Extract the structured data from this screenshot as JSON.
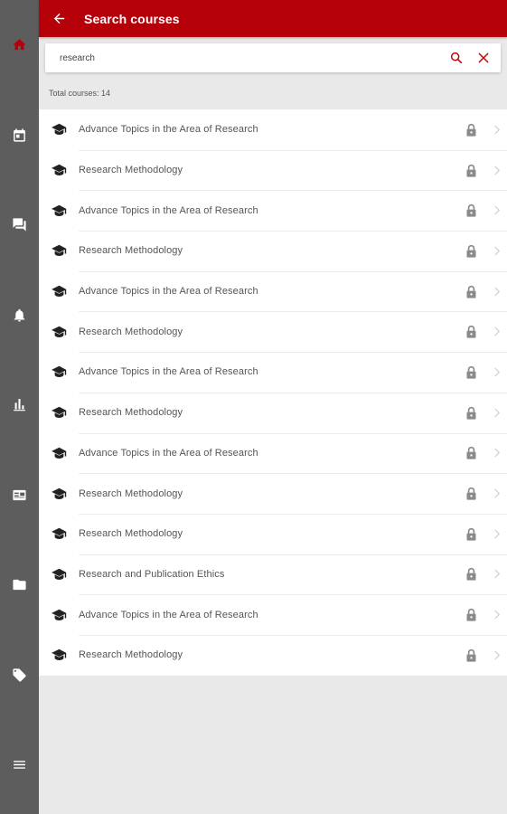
{
  "colors": {
    "brand": "#b50009",
    "rail": "#5d5d5d",
    "active_rail_icon": "#b50009"
  },
  "rail": {
    "items": [
      {
        "icon": "home-icon",
        "active": true
      },
      {
        "icon": "calendar-icon"
      },
      {
        "icon": "forum-icon"
      },
      {
        "icon": "bell-icon"
      },
      {
        "icon": "bar-chart-icon"
      },
      {
        "icon": "id-card-icon"
      },
      {
        "icon": "folder-icon"
      },
      {
        "icon": "tag-icon"
      },
      {
        "icon": "menu-icon"
      }
    ]
  },
  "appbar": {
    "title": "Search courses",
    "back_icon": "arrow-back-icon"
  },
  "search": {
    "value": "research",
    "search_icon": "search-icon",
    "clear_icon": "close-icon"
  },
  "total_label": "Total courses: 14",
  "courses": [
    {
      "title": "Advance Topics in the Area of Research"
    },
    {
      "title": "Research Methodology"
    },
    {
      "title": "Advance Topics in the Area of Research"
    },
    {
      "title": "Research Methodology"
    },
    {
      "title": "Advance Topics in the Area of Research"
    },
    {
      "title": "Research Methodology"
    },
    {
      "title": "Advance Topics in the Area of Research"
    },
    {
      "title": "Research Methodology"
    },
    {
      "title": "Advance Topics in the Area of Research"
    },
    {
      "title": "Research Methodology"
    },
    {
      "title": "Research Methodology"
    },
    {
      "title": "Research and Publication Ethics"
    },
    {
      "title": "Advance Topics in the Area of Research"
    },
    {
      "title": "Research Methodology"
    }
  ]
}
